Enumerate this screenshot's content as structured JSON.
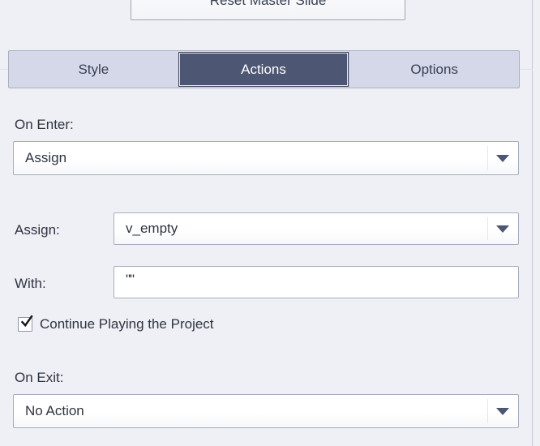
{
  "panel": {
    "top_button": {
      "label": "Reset Master Slide"
    },
    "tabs": [
      {
        "label": "Style",
        "active": false
      },
      {
        "label": "Actions",
        "active": true
      },
      {
        "label": "Options",
        "active": false
      }
    ],
    "fields": {
      "on_enter": {
        "label": "On Enter:",
        "value": "Assign",
        "arrow_icon": "chevron-down-icon"
      },
      "assign": {
        "label": "Assign:",
        "value": "v_empty",
        "arrow_icon": "chevron-down-icon"
      },
      "with": {
        "label": "With:",
        "value": "\"\"",
        "placeholder": ""
      },
      "continue_playing": {
        "label": "Continue Playing the Project",
        "checked": true,
        "check_icon": "checkmark-icon"
      },
      "on_exit": {
        "label": "On Exit:",
        "value": "No Action",
        "arrow_icon": "chevron-down-icon"
      }
    }
  },
  "colors": {
    "panel_background": "#eff0f5",
    "tabstrip_background": "#d4d8e8",
    "active_tab_background": "#4d5672",
    "active_tab_text": "#ffffff",
    "text": "#2e3440",
    "border": "#a7adbe"
  }
}
